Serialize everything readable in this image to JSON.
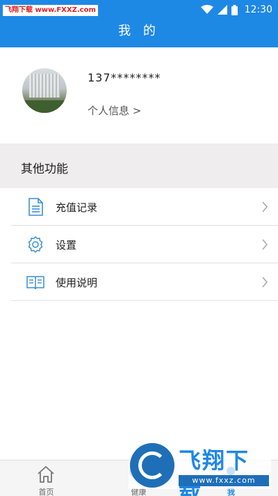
{
  "status_bar": {
    "watermark": "飞翔下载 www.FXXZ.com",
    "time": "12:30",
    "icons": [
      "wifi-icon",
      "signal-icon",
      "battery-icon"
    ]
  },
  "header": {
    "title": "我 的"
  },
  "profile": {
    "phone": "137********",
    "info_link": "个人信息 >"
  },
  "section": {
    "title": "其他功能"
  },
  "menu": {
    "items": [
      {
        "label": "充值记录",
        "icon": "document-icon"
      },
      {
        "label": "设置",
        "icon": "gear-icon"
      },
      {
        "label": "使用说明",
        "icon": "book-icon"
      }
    ]
  },
  "bottom_nav": {
    "tabs": [
      {
        "label": "首页",
        "icon": "home-icon",
        "active": false
      },
      {
        "label": "健康",
        "icon": "health-icon",
        "active": false
      },
      {
        "label": "我",
        "icon": "user-icon",
        "active": true
      }
    ]
  },
  "watermark_logo": {
    "title": "飞翔下载",
    "url": "www.fxxz.com"
  },
  "colors": {
    "primary": "#1e88e5",
    "section_bg": "#efeded",
    "divider": "#e2e2e2"
  }
}
